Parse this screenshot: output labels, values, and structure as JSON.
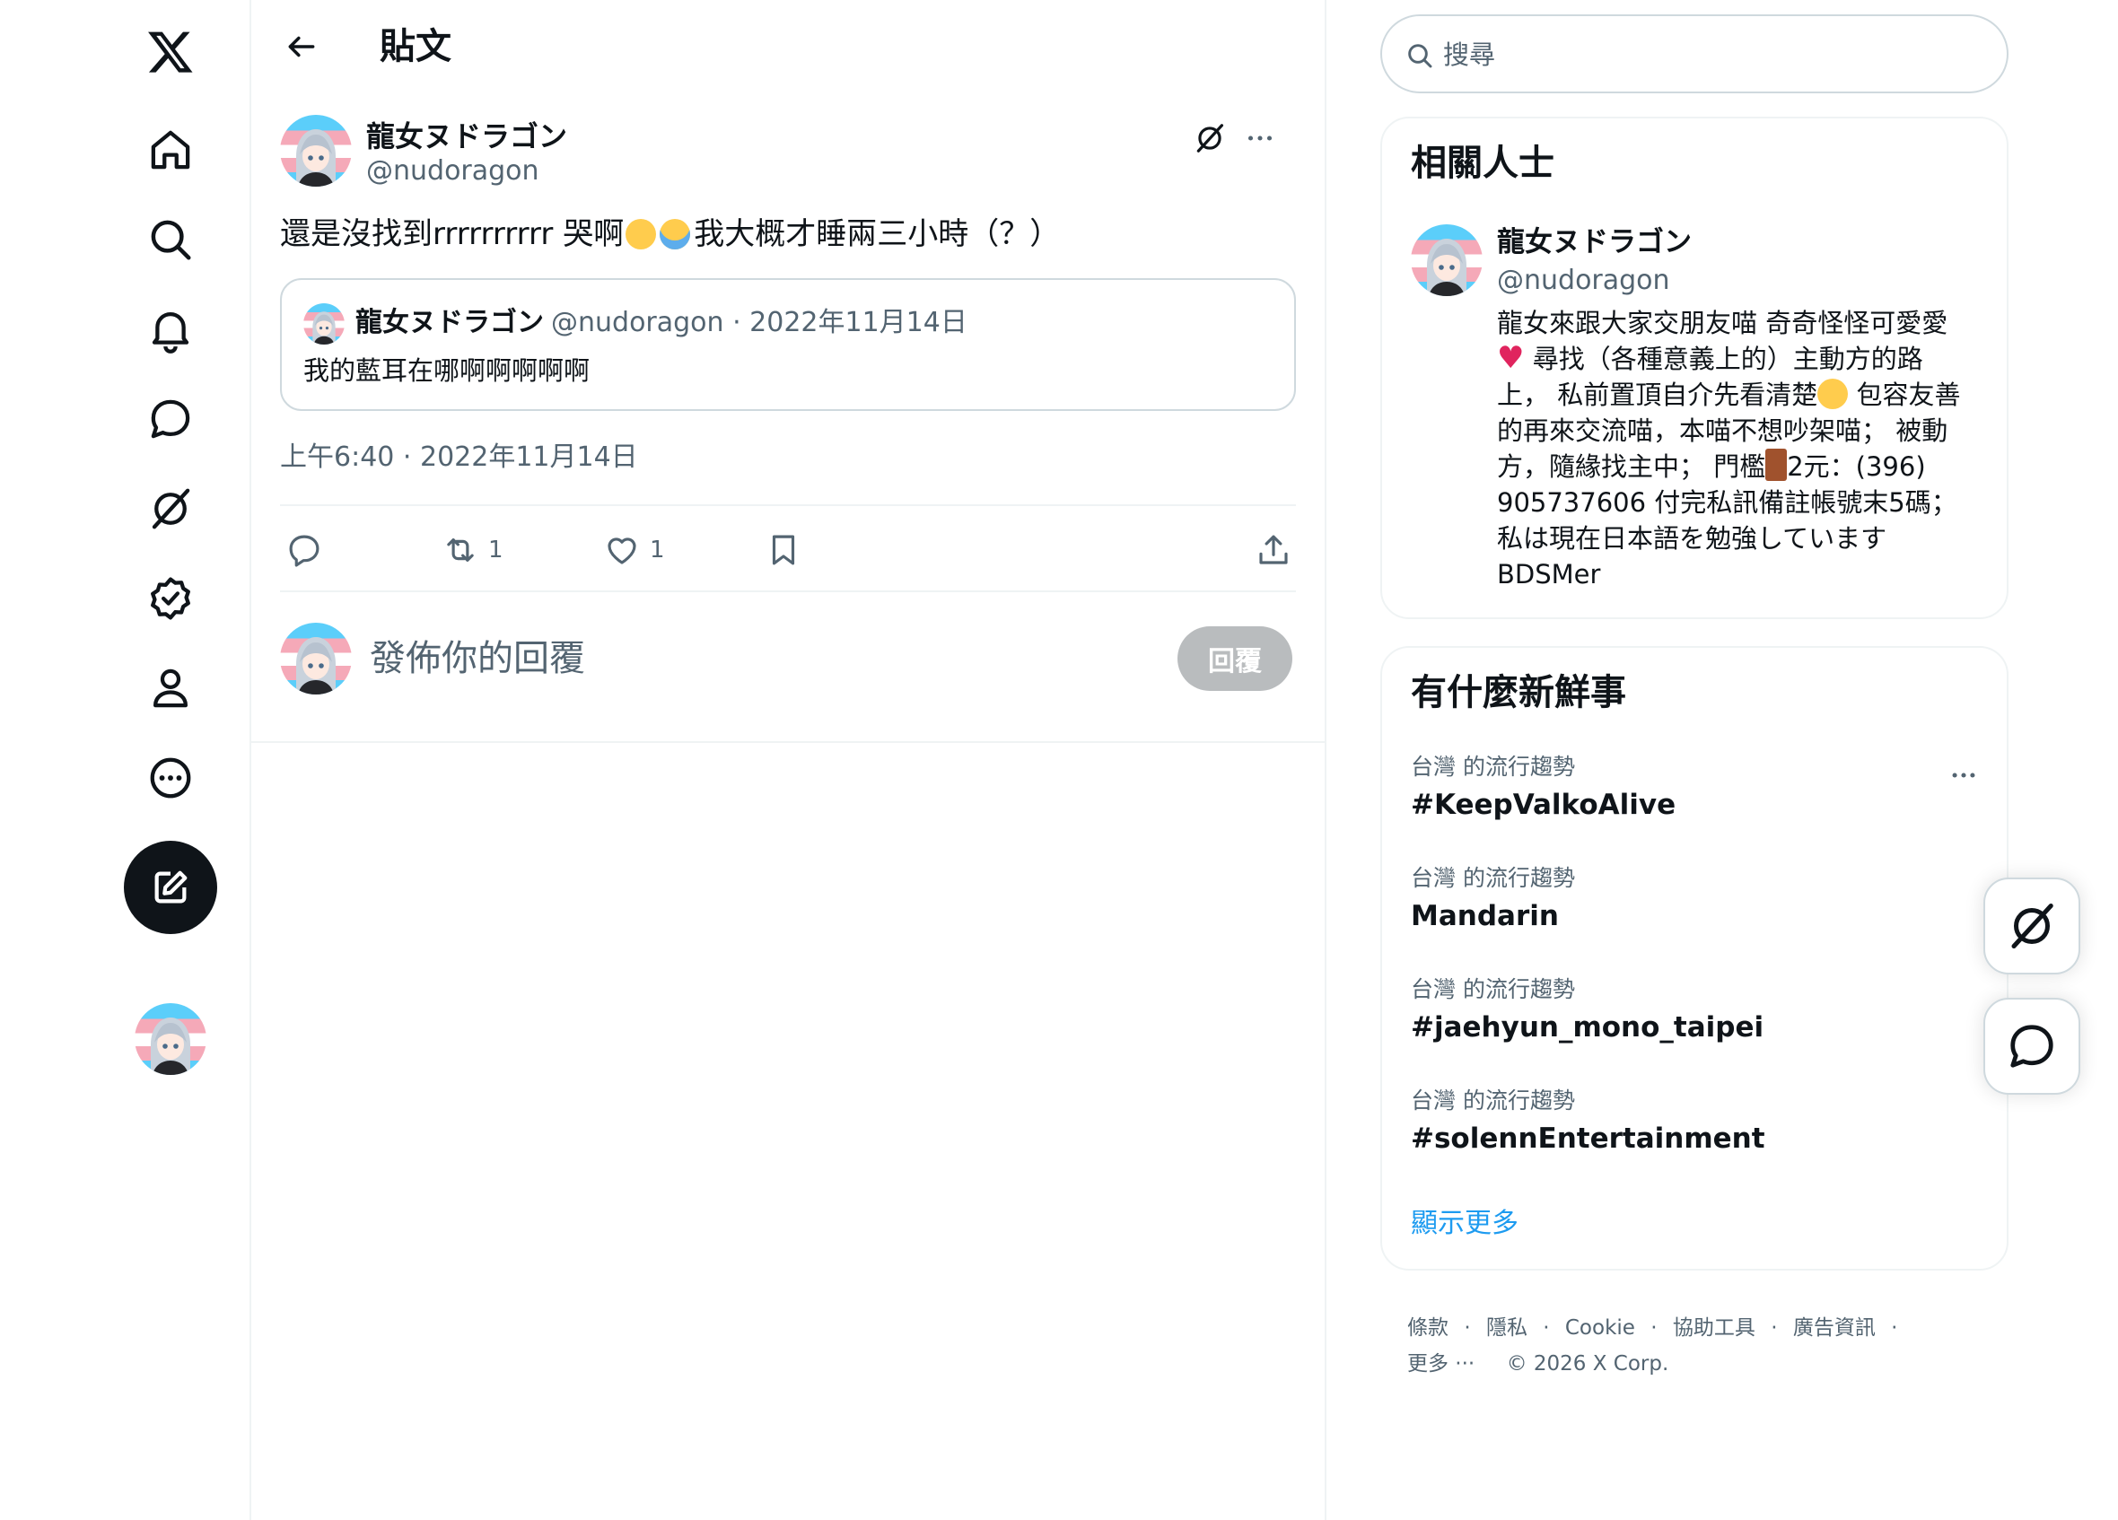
{
  "nav": {
    "items": [
      {
        "icon": "x-logo-icon"
      },
      {
        "icon": "home-icon"
      },
      {
        "icon": "search-icon"
      },
      {
        "icon": "notifications-icon"
      },
      {
        "icon": "messages-icon"
      },
      {
        "icon": "grok-icon"
      },
      {
        "icon": "verified-icon"
      },
      {
        "icon": "profile-icon"
      },
      {
        "icon": "more-icon"
      }
    ],
    "compose_icon": "compose-icon"
  },
  "header": {
    "title": "貼文"
  },
  "post": {
    "author_name": "龍女ヌドラゴン",
    "author_handle": "@nudoragon",
    "text_before": "還是沒找到rrrrrrrrrr 哭啊",
    "text_after": "我大概才睡兩三小時（？）",
    "quote": {
      "author_name": "龍女ヌドラゴン",
      "meta": "@nudoragon · 2022年11月14日",
      "text": "我的藍耳在哪啊啊啊啊啊"
    },
    "timestamp": "上午6:40 · 2022年11月14日",
    "stats": {
      "retweets": "1",
      "likes": "1"
    },
    "reply": {
      "placeholder": "發佈你的回覆",
      "button": "回覆"
    }
  },
  "search": {
    "placeholder": "搜尋"
  },
  "related": {
    "title": "相關人士",
    "name": "龍女ヌドラゴン",
    "handle": "@nudoragon",
    "bio": {
      "line1": "龍女來跟大家交朋友喵 奇奇怪怪可愛愛",
      "line2": " 尋找（各種意義上的）主動方的路",
      "line3a": "上， 私前置頂自介先看清楚",
      "line3b": " 包容友善",
      "line4": "的再來交流喵，本喵不想吵架喵； 被動",
      "line5a": "方，隨緣找主中； 門檻",
      "line5b": "2元：(396)",
      "line6": "905737606 付完私訊備註帳號末5碼；",
      "line7": "私は現在日本語を勉強しています",
      "line8": "BDSMer"
    }
  },
  "trends": {
    "title": "有什麼新鮮事",
    "items": [
      {
        "meta": "台灣 的流行趨勢",
        "title": "#KeepValkoAlive"
      },
      {
        "meta": "台灣 的流行趨勢",
        "title": "Mandarin"
      },
      {
        "meta": "台灣 的流行趨勢",
        "title": "#jaehyun_mono_taipei"
      },
      {
        "meta": "台灣 的流行趨勢",
        "title": "#solennEntertainment"
      }
    ],
    "show_more": "顯示更多"
  },
  "footer": {
    "links": [
      "條款",
      "·",
      "隱私",
      "·",
      "Cookie",
      "·",
      "協助工具",
      "·",
      "廣告資訊",
      "·"
    ],
    "more": "更多 ···",
    "copyright": "© 2026 X Corp."
  },
  "colors": {
    "text": "#0f1419",
    "secondary": "#536471",
    "link": "#1d9bf0",
    "border": "#eff3f4",
    "reply_disabled": "#b9bcbe"
  }
}
